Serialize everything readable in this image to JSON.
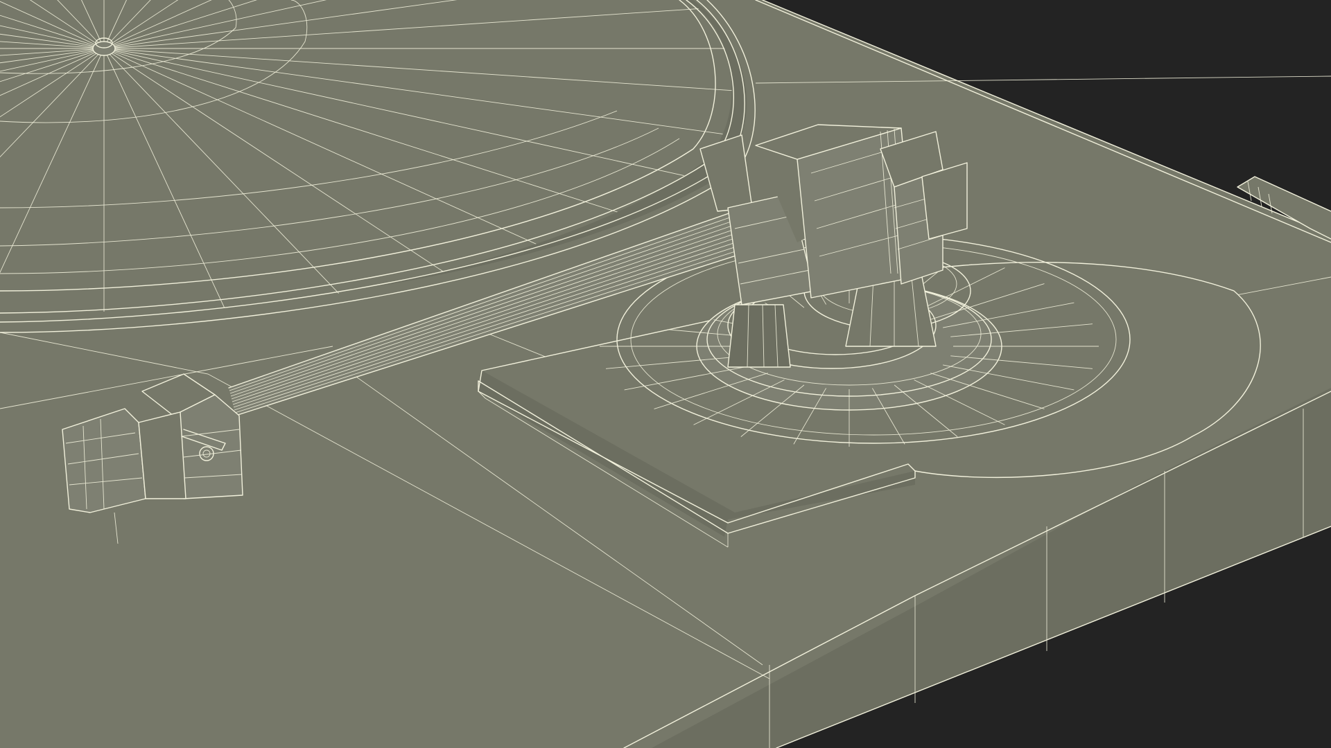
{
  "scene": {
    "subject": "turntable-wireframe-render",
    "background_color": "#232323",
    "surface_color": "#767869",
    "wire_color": "#f2f1dc",
    "platter_spokes": 36,
    "tonearm_base_segments": 28
  }
}
